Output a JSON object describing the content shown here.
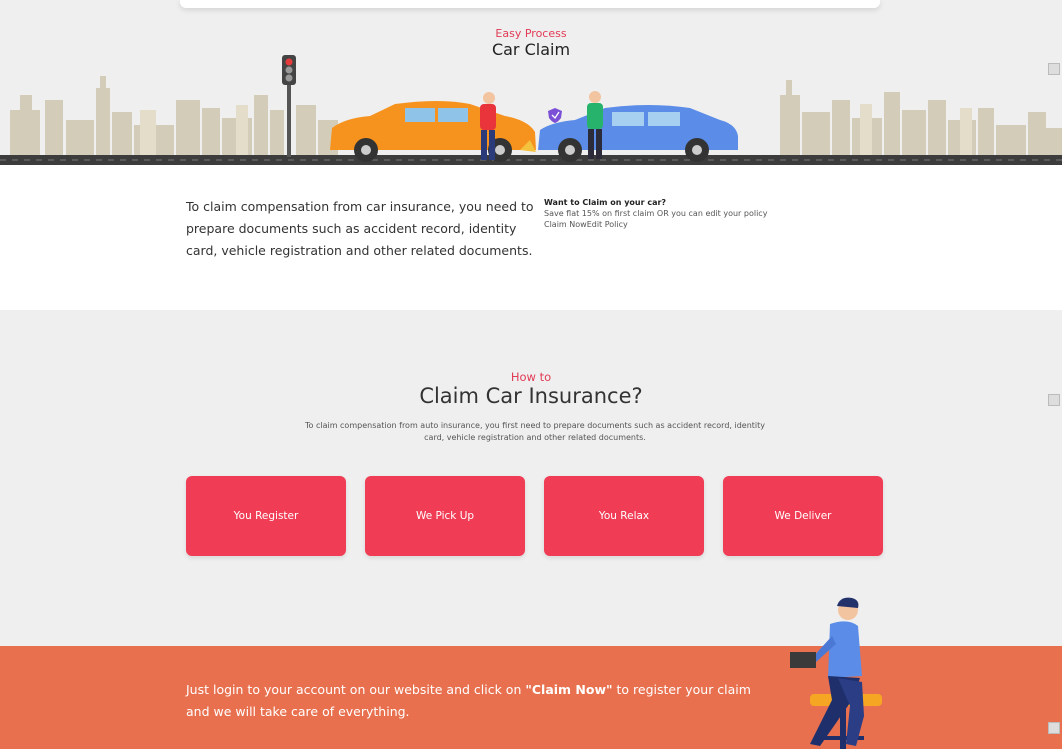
{
  "hero": {
    "eyebrow": "Easy Process",
    "title": "Car Claim"
  },
  "intro": {
    "text": "To claim compensation from car insurance, you need to prepare documents such as accident record, identity card, vehicle registration and other related documents."
  },
  "claim_box": {
    "heading": "Want to Claim on your car?",
    "subtext": "Save flat 15% on first claim OR you can edit your policy",
    "claim_now_link": "Claim Now",
    "edit_policy_link": "Edit Policy"
  },
  "how": {
    "eyebrow": "How to",
    "title": "Claim Car Insurance?",
    "description": "To claim compensation from auto insurance, you first need to prepare documents such as accident record, identity card, vehicle registration and other related documents.",
    "steps": [
      {
        "label": "You Register"
      },
      {
        "label": "We Pick Up"
      },
      {
        "label": "You Relax"
      },
      {
        "label": "We Deliver"
      }
    ]
  },
  "banner": {
    "text_before": "Just login to your account on our website and click on ",
    "highlight": "\"Claim Now\"",
    "text_after": " to register your claim and we will take care of everything."
  },
  "colors": {
    "accent": "#f03d55",
    "eyebrow": "#e23b55",
    "banner": "#e8704e",
    "section_bg": "#efefef"
  }
}
